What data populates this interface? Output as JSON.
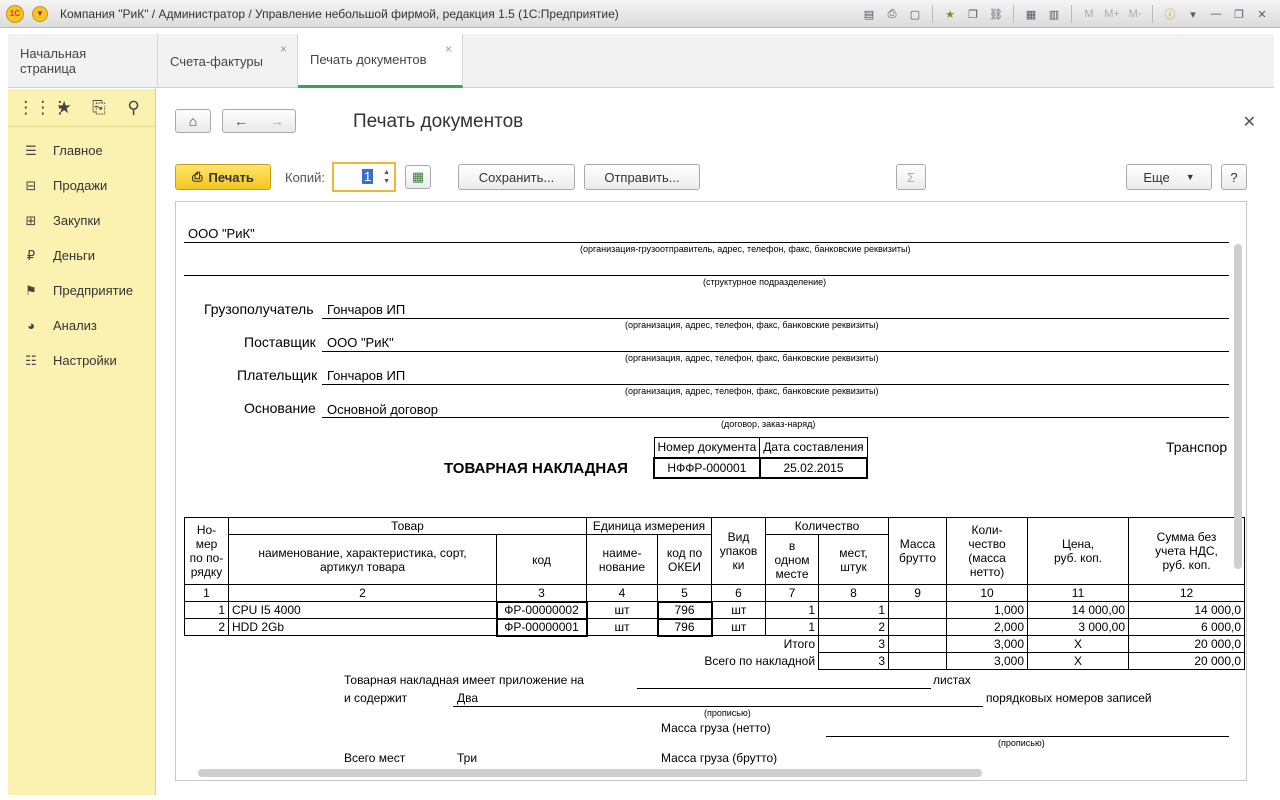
{
  "window": {
    "title": "Компания \"РиК\" / Администратор / Управление небольшой фирмой, редакция 1.5  (1С:Предприятие)",
    "logo": "1С",
    "toolbar_letters": [
      "M",
      "M+",
      "M-"
    ]
  },
  "tabs": [
    {
      "label": "Начальная страница",
      "closable": false
    },
    {
      "label": "Счета-фактуры",
      "closable": true
    },
    {
      "label": "Печать документов",
      "closable": true,
      "active": true
    }
  ],
  "sidebar": {
    "top_icons": [
      "apps-grid-icon",
      "star-icon",
      "history-icon",
      "search-icon"
    ],
    "items": [
      {
        "label": "Главное",
        "icon": "list-icon"
      },
      {
        "label": "Продажи",
        "icon": "basket-icon"
      },
      {
        "label": "Закупки",
        "icon": "cart-icon"
      },
      {
        "label": "Деньги",
        "icon": "ruble-icon"
      },
      {
        "label": "Предприятие",
        "icon": "flag-icon"
      },
      {
        "label": "Анализ",
        "icon": "pie-icon"
      },
      {
        "label": "Настройки",
        "icon": "settings-icon"
      }
    ]
  },
  "page": {
    "title": "Печать документов",
    "print_label": "Печать",
    "copies_label": "Копий:",
    "copies_value": "1",
    "save_label": "Сохранить...",
    "send_label": "Отправить...",
    "more_label": "Еще",
    "help_label": "?"
  },
  "doc": {
    "shipper": "ООО \"РиК\"",
    "shipper_hint": "(организация-грузоотправитель, адрес, телефон, факс, банковские реквизиты)",
    "division_hint": "(структурное подразделение)",
    "consignee_label": "Грузополучатель",
    "consignee": "Гончаров ИП",
    "org_hint": "(организация, адрес, телефон, факс, банковские реквизиты)",
    "supplier_label": "Поставщик",
    "supplier": "ООО \"РиК\"",
    "payer_label": "Плательщик",
    "payer": "Гончаров ИП",
    "basis_label": "Основание",
    "basis": "Основной договор",
    "basis_hint": "(договор, заказ-наряд)",
    "doc_title": "ТОВАРНАЯ НАКЛАДНАЯ",
    "docnum_header": "Номер документа",
    "date_header": "Дата составления",
    "docnum": "НФФР-000001",
    "date": "25.02.2015",
    "transport": "Транспор",
    "headers": {
      "num": "Но-\nмер\nпо по-\nрядку",
      "goods": "Товар",
      "goods_name": "наименование, характеристика, сорт,\nартикул товара",
      "goods_code": "код",
      "unit": "Единица измерения",
      "unit_name": "наиме-\nнование",
      "unit_code": "код по\nОКЕИ",
      "pack": "Вид\nупаков\nки",
      "qty": "Количество",
      "qty_in_one": "в\nодном\nместе",
      "qty_places": "мест,\nштук",
      "mass": "Масса\nбрутто",
      "qty_net": "Коли-\nчество\n(масса\nнетто)",
      "price": "Цена,\nруб. коп.",
      "sum": "Сумма без\nучета НДС,\nруб. коп."
    },
    "col_numbers": [
      "1",
      "2",
      "3",
      "4",
      "5",
      "6",
      "7",
      "8",
      "9",
      "10",
      "11",
      "12"
    ],
    "rows": [
      {
        "n": "1",
        "name": "CPU I5 4000",
        "code": "ФР-00000002",
        "unit": "шт",
        "okei": "796",
        "pack": "шт",
        "in_one": "1",
        "places": "1",
        "mass": "",
        "qty": "1,000",
        "price": "14 000,00",
        "sum": "14 000,0"
      },
      {
        "n": "2",
        "name": "HDD 2Gb",
        "code": "ФР-00000001",
        "unit": "шт",
        "okei": "796",
        "pack": "шт",
        "in_one": "1",
        "places": "2",
        "mass": "",
        "qty": "2,000",
        "price": "3 000,00",
        "sum": "6 000,0"
      }
    ],
    "total_label": "Итого",
    "total_places": "3",
    "total_qty": "3,000",
    "total_price": "X",
    "total_sum": "20 000,0",
    "grand_label": "Всего по накладной",
    "grand_places": "3",
    "grand_qty": "3,000",
    "grand_price": "X",
    "grand_sum": "20 000,0",
    "appendix_text": "Товарная накладная имеет приложение на",
    "sheets": "листах",
    "contains": "и содержит",
    "records_count": "Два",
    "records_text": "порядковых номеров записей",
    "in_words": "(прописью)",
    "net_mass": "Масса груза (нетто)",
    "total_places_label": "Всего мест",
    "places_words": "Три",
    "gross_mass": "Масса груза (брутто)"
  }
}
